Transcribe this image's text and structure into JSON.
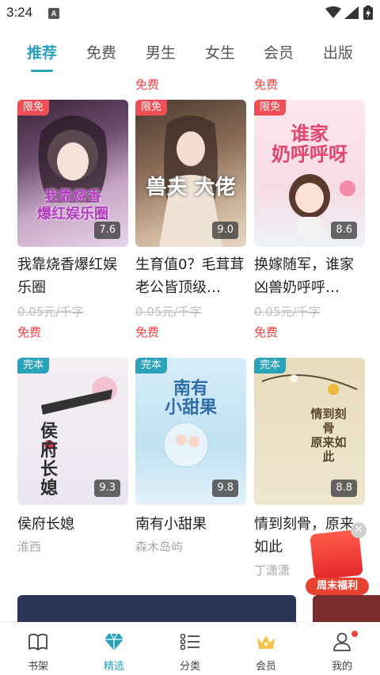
{
  "status_bar": {
    "time": "3:24",
    "notification_icon": "A"
  },
  "tabs": [
    {
      "label": "推荐",
      "active": true
    },
    {
      "label": "免费",
      "active": false
    },
    {
      "label": "男生",
      "active": false
    },
    {
      "label": "女生",
      "active": false
    },
    {
      "label": "会员",
      "active": false
    },
    {
      "label": "出版",
      "active": false
    }
  ],
  "row1_tags": [
    "免费",
    "免费"
  ],
  "books": [
    {
      "badge": "限免",
      "score": "7.6",
      "title": "我靠烧香爆红娱乐圈",
      "price": "0.05元/千字",
      "tag": "免费",
      "cover_text": "我靠烧香\n爆红娱乐圈"
    },
    {
      "badge": "限免",
      "score": "9.0",
      "title": "生育值0？毛茸茸老公皆顶级…",
      "price": "0.05元/千字",
      "tag": "免费",
      "cover_text": "兽夫 大佬"
    },
    {
      "badge": "限免",
      "score": "8.6",
      "title": "换嫁随军，谁家凶兽奶呼呼…",
      "price": "0.05元/千字",
      "tag": "免费",
      "cover_text": "谁家\n奶呼呼呀"
    },
    {
      "badge": "完本",
      "score": "9.3",
      "title": "侯府长媳",
      "author": "淮西",
      "cover_text": "侯府长媳"
    },
    {
      "badge": "完本",
      "score": "9.8",
      "title": "南有小甜果",
      "author": "森木岛屿",
      "cover_text": "南有\n小甜果"
    },
    {
      "badge": "完本",
      "score": "8.8",
      "title": "情到刻骨，原来如此",
      "author": "丁潇潇",
      "cover_text": "情到刻骨\n原来如此"
    }
  ],
  "promo": {
    "label": "周末福利",
    "close": "✕"
  },
  "bottom_nav": [
    {
      "label": "书架",
      "icon": "book-icon"
    },
    {
      "label": "精选",
      "icon": "diamond-icon",
      "active": true
    },
    {
      "label": "分类",
      "icon": "list-icon"
    },
    {
      "label": "会员",
      "icon": "crown-icon"
    },
    {
      "label": "我的",
      "icon": "user-icon",
      "badge_dot": true
    }
  ],
  "colors": {
    "accent": "#2aa2b8",
    "free_red": "#f04040",
    "limited_badge": "#ef4e55",
    "complete_badge": "#2aa2b8"
  }
}
